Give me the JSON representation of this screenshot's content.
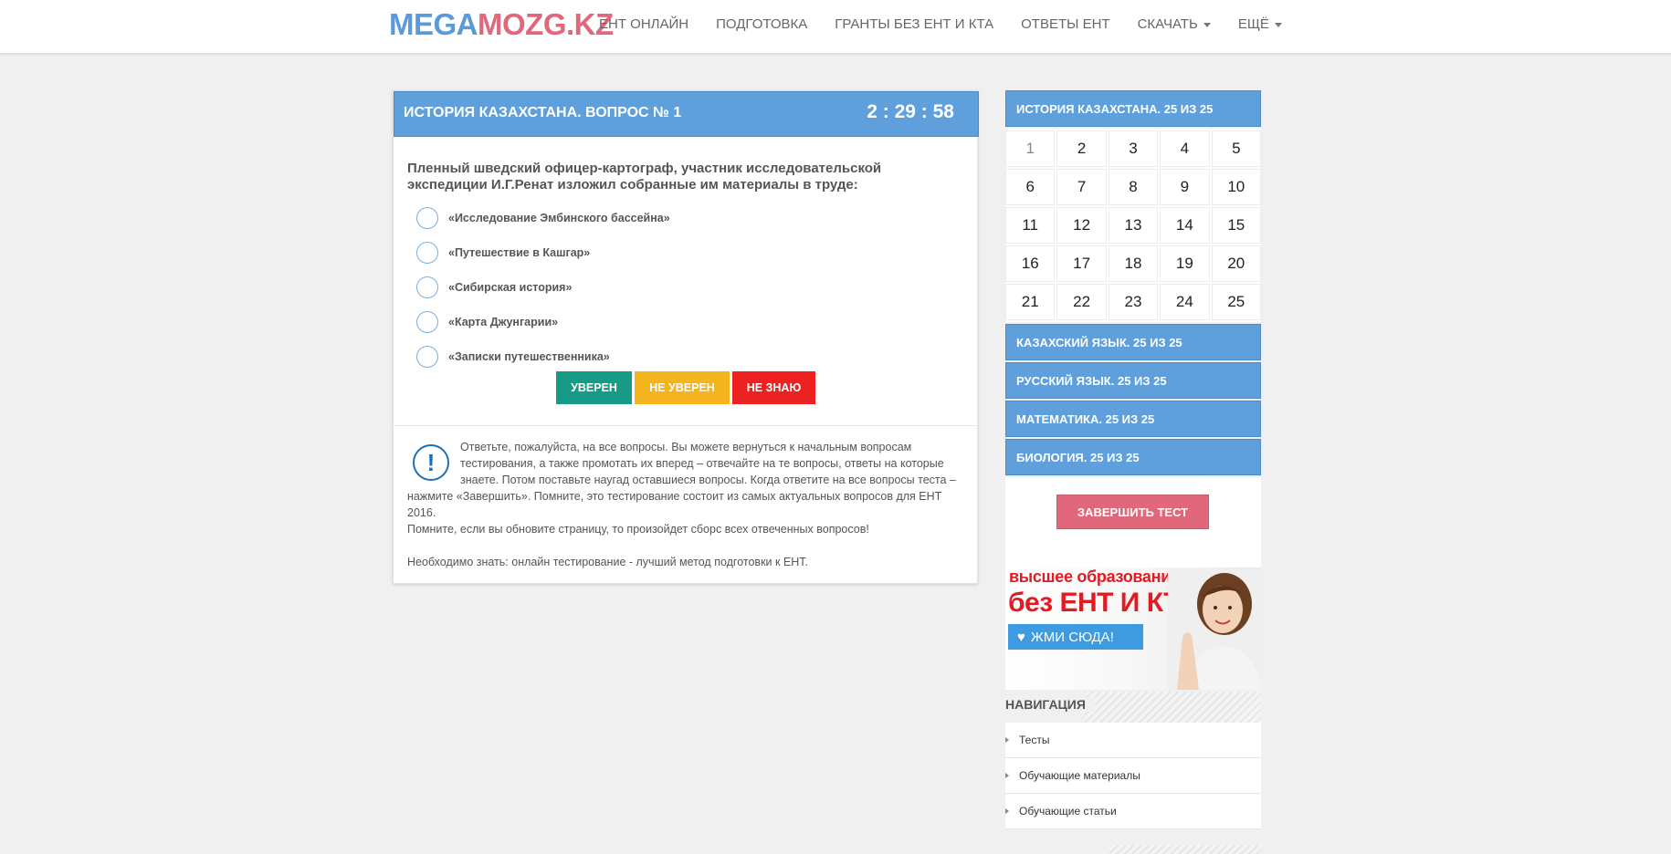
{
  "header": {
    "logo_part1": "MEGA",
    "logo_part2": "MOZG.KZ",
    "nav": [
      {
        "label": "ЕНТ ОНЛАЙН",
        "dropdown": false
      },
      {
        "label": "ПОДГОТОВКА",
        "dropdown": false
      },
      {
        "label": "ГРАНТЫ БЕЗ ЕНТ И КТА",
        "dropdown": false
      },
      {
        "label": "ОТВЕТЫ ЕНТ",
        "dropdown": false
      },
      {
        "label": "СКАЧАТЬ",
        "dropdown": true
      },
      {
        "label": "ЕЩЁ",
        "dropdown": true
      }
    ]
  },
  "question_panel": {
    "title": "ИСТОРИЯ КАЗАХСТАНА. ВОПРОС № 1",
    "timer": "2 : 29 : 58",
    "question_line1": "Пленный шведский офицер-картограф, участник  исследовательской",
    "question_line2": "экспедиции  И.Г.Ренат изложил собранные им материалы в труде:",
    "options": [
      "«Исследование Эмбинского  бассейна»",
      "«Путешествие в Кашгар»",
      "«Сибирская  история»",
      "«Карта Джунгарии»",
      "«Записки  путешественника»"
    ],
    "buttons": {
      "sure": "УВЕРЕН",
      "unsure": "НЕ УВЕРЕН",
      "dunno": "НЕ ЗНАЮ"
    },
    "notice": {
      "icon": "exclamation-icon",
      "para1": "Ответьте, пожалуйста, на все вопросы. Вы можете вернуться к начальным вопросам тестирования, а также промотать их вперед – отвечайте на те вопросы, ответы на которые знаете. Потом поставьте наугад оставшиеся вопросы. Когда ответите на все вопросы теста – нажмите «Завершить». Помните, это тестирование состоит из самых актуальных вопросов для ЕНТ 2016.",
      "para2": "Помните, если вы обновите страницу, то произойдет сборс всех отвеченных вопросов!",
      "para3": "Необходимо знать: онлайн тестирование - лучший метод подготовки к ЕНТ."
    }
  },
  "sidebar": {
    "subjects": [
      {
        "label": "ИСТОРИЯ КАЗАХСТАНА. 25 ИЗ 25"
      },
      {
        "label": "КАЗАХСКИЙ ЯЗЫК. 25 ИЗ 25"
      },
      {
        "label": "РУССКИЙ ЯЗЫК. 25 ИЗ 25"
      },
      {
        "label": "МАТЕМАТИКА. 25 ИЗ 25"
      },
      {
        "label": "БИОЛОГИЯ. 25 ИЗ 25"
      }
    ],
    "question_numbers": [
      "1",
      "2",
      "3",
      "4",
      "5",
      "6",
      "7",
      "8",
      "9",
      "10",
      "11",
      "12",
      "13",
      "14",
      "15",
      "16",
      "17",
      "18",
      "19",
      "20",
      "21",
      "22",
      "23",
      "24",
      "25"
    ],
    "active_question": "1",
    "finish_button": "ЗАВЕРШИТЬ ТЕСТ"
  },
  "banner": {
    "line1": "высшее образование",
    "line2": "без  ЕНТ И КТА",
    "cta": "ЖМИ СЮДА!",
    "cta_icon": "heart-icon"
  },
  "navigation": {
    "title": "НАВИГАЦИЯ",
    "items": [
      "Тесты",
      "Обучающие материалы",
      "Обучающие статьи"
    ]
  },
  "colors": {
    "accent_blue": "#5e9fdc",
    "logo_blue": "#5b9ad8",
    "logo_pink": "#e0687a",
    "sure_green": "#159b86",
    "unsure_yellow": "#f4b41e",
    "dunno_red": "#ee2121",
    "finish_pink": "#e0687a"
  }
}
